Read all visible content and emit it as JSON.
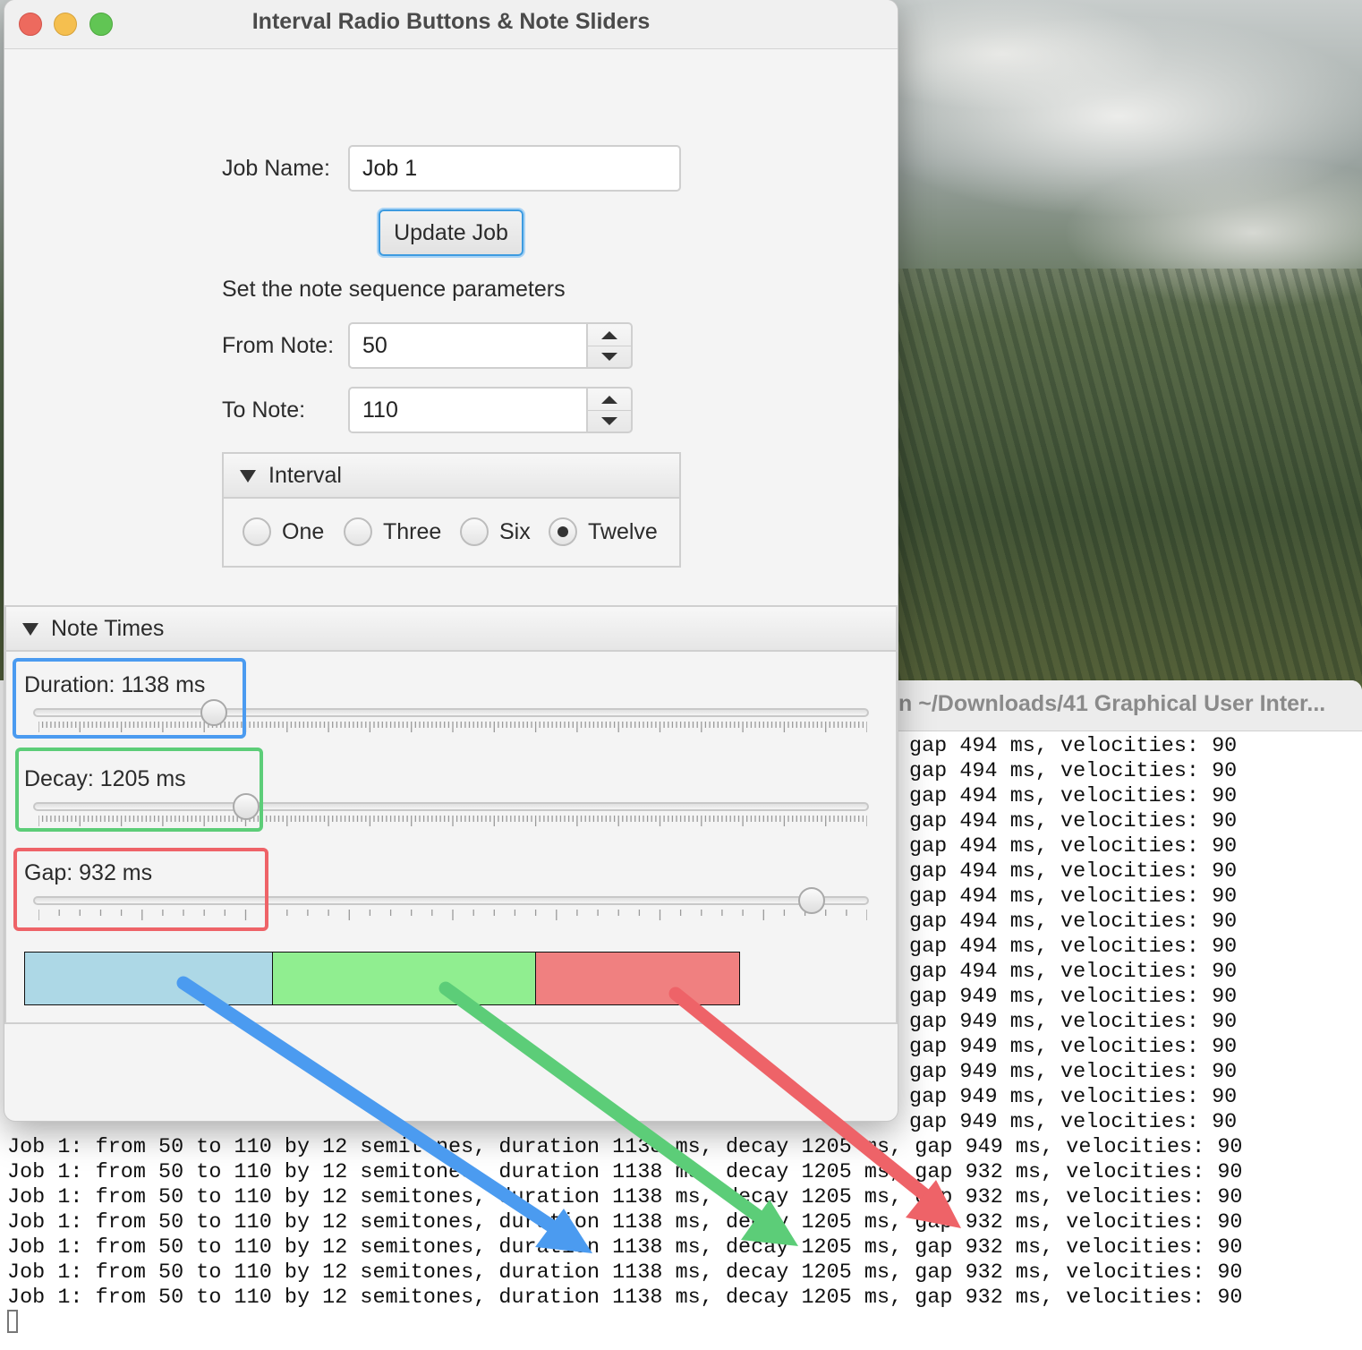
{
  "window": {
    "title": "Interval Radio Buttons & Note Sliders"
  },
  "job": {
    "name_label": "Job Name:",
    "name_value": "Job 1",
    "update_label": "Update Job"
  },
  "sequence": {
    "heading": "Set the note sequence parameters",
    "from_label": "From Note:",
    "from_value": "50",
    "to_label": "To Note:",
    "to_value": "110"
  },
  "interval": {
    "title": "Interval",
    "options": [
      "One",
      "Three",
      "Six",
      "Twelve"
    ],
    "selected": "Twelve"
  },
  "note_times": {
    "title": "Note Times",
    "duration": {
      "label": "Duration: 1138 ms",
      "value_ms": 1138,
      "fraction": 0.216
    },
    "decay": {
      "label": "Decay: 1205 ms",
      "value_ms": 1205,
      "fraction": 0.255
    },
    "gap": {
      "label": "Gap: 932 ms",
      "value_ms": 932,
      "fraction": 0.932
    }
  },
  "timeline": {
    "segments": [
      {
        "name": "duration",
        "color": "#add8e6"
      },
      {
        "name": "decay",
        "color": "#90ee90"
      },
      {
        "name": "gap",
        "color": "#f08080"
      }
    ]
  },
  "annotations": {
    "duration_color": "#4b9bf0",
    "decay_color": "#5ccd78",
    "gap_color": "#ee6368"
  },
  "terminal": {
    "title": "n ~/Downloads/41 Graphical User Inter...",
    "right_lines": [
      "gap 494 ms, velocities: 90",
      "gap 494 ms, velocities: 90",
      "gap 494 ms, velocities: 90",
      "gap 494 ms, velocities: 90",
      "gap 494 ms, velocities: 90",
      "gap 494 ms, velocities: 90",
      "gap 494 ms, velocities: 90",
      "gap 494 ms, velocities: 90",
      "gap 494 ms, velocities: 90",
      "gap 494 ms, velocities: 90",
      "gap 949 ms, velocities: 90",
      "gap 949 ms, velocities: 90",
      "gap 949 ms, velocities: 90",
      "gap 949 ms, velocities: 90",
      "gap 949 ms, velocities: 90",
      "gap 949 ms, velocities: 90"
    ],
    "full_lines": [
      "Job 1: from 50 to 110 by 12 semitones, duration 1138 ms, decay 1205 ms, gap 949 ms, velocities: 90",
      "Job 1: from 50 to 110 by 12 semitones, duration 1138 ms, decay 1205 ms, gap 932 ms, velocities: 90",
      "Job 1: from 50 to 110 by 12 semitones, duration 1138 ms, decay 1205 ms, gap 932 ms, velocities: 90",
      "Job 1: from 50 to 110 by 12 semitones, duration 1138 ms, decay 1205 ms, gap 932 ms, velocities: 90",
      "Job 1: from 50 to 110 by 12 semitones, duration 1138 ms, decay 1205 ms, gap 932 ms, velocities: 90",
      "Job 1: from 50 to 110 by 12 semitones, duration 1138 ms, decay 1205 ms, gap 932 ms, velocities: 90",
      "Job 1: from 50 to 110 by 12 semitones, duration 1138 ms, decay 1205 ms, gap 932 ms, velocities: 90"
    ]
  }
}
